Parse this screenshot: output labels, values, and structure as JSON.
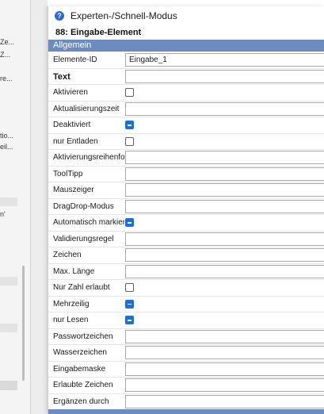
{
  "window": {
    "title": "Experten-/Schnell-Modus",
    "help_icon": "?"
  },
  "element_title": "88: Eingabe-Element",
  "section": {
    "label": "Allgemein"
  },
  "left_pane": {
    "texts": [
      "Ze...",
      "Z...",
      "re...",
      "tio...",
      "eil...",
      "n'"
    ]
  },
  "properties": [
    {
      "label": "Elemente-ID",
      "type": "text",
      "value": "Eingabe_1"
    },
    {
      "label": "Text",
      "type": "text",
      "value": "",
      "bold": true
    },
    {
      "label": "Aktivieren",
      "type": "checkbox",
      "checked": false
    },
    {
      "label": "Aktualisierungszeit",
      "type": "text",
      "value": ""
    },
    {
      "label": "Deaktiviert",
      "type": "checkbox",
      "checked": true
    },
    {
      "label": "nur Entladen",
      "type": "checkbox",
      "checked": false
    },
    {
      "label": "Aktivierungsreihenfolge",
      "type": "text",
      "value": ""
    },
    {
      "label": "ToolTipp",
      "type": "text",
      "value": ""
    },
    {
      "label": "Mauszeiger",
      "type": "text",
      "value": ""
    },
    {
      "label": "DragDrop-Modus",
      "type": "text",
      "value": ""
    },
    {
      "label": "Automatisch markieren",
      "type": "checkbox",
      "checked": true
    },
    {
      "label": "Validierungsregel",
      "type": "text",
      "value": ""
    },
    {
      "label": "Zeichen",
      "type": "text",
      "value": ""
    },
    {
      "label": "Max. Länge",
      "type": "text",
      "value": ""
    },
    {
      "label": "Nur Zahl erlaubt",
      "type": "checkbox",
      "checked": false
    },
    {
      "label": "Mehrzeilig",
      "type": "checkbox",
      "checked": true
    },
    {
      "label": "nur Lesen",
      "type": "checkbox",
      "checked": true
    },
    {
      "label": "Passwortzeichen",
      "type": "text",
      "value": ""
    },
    {
      "label": "Wasserzeichen",
      "type": "text",
      "value": ""
    },
    {
      "label": "Eingabemaske",
      "type": "text",
      "value": ""
    },
    {
      "label": "Erlaubte Zeichen",
      "type": "text",
      "value": ""
    },
    {
      "label": "Ergänzen durch",
      "type": "text",
      "value": ""
    }
  ],
  "colors": {
    "section_header": "#6b8cc0",
    "checkbox_checked": "#1f6ed4",
    "help_icon": "#2a6ad8"
  }
}
